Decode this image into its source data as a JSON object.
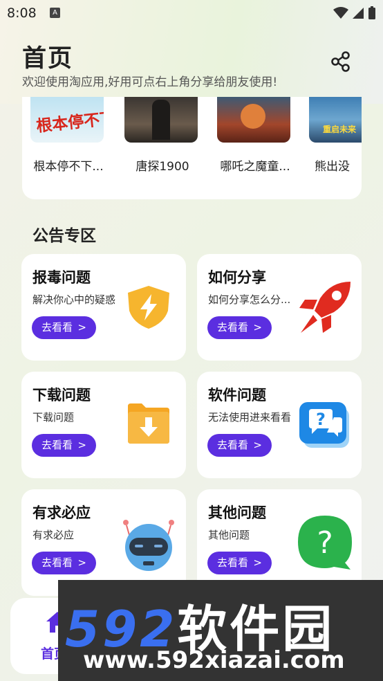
{
  "status_bar": {
    "time": "8:08",
    "notification_letter": "A"
  },
  "header": {
    "title": "首页",
    "subtitle": "欢迎使用淘应用,好用可点右上角分享给朋友使用!"
  },
  "movies": [
    {
      "name": "根本停不下...",
      "poster_text": "根本停不下来"
    },
    {
      "name": "唐探1900",
      "poster_text": ""
    },
    {
      "name": "哪吒之魔童...",
      "poster_text": ""
    },
    {
      "name": "熊出没",
      "poster_text": "重启未来"
    }
  ],
  "notice_section": {
    "title": "公告专区",
    "button_label": "去看看",
    "cards": [
      {
        "title": "报毒问题",
        "desc": "解决你心中的疑惑",
        "icon": "shield-lightning-icon"
      },
      {
        "title": "如何分享",
        "desc": "如何分享怎么分...",
        "icon": "rocket-icon"
      },
      {
        "title": "下载问题",
        "desc": "下载问题",
        "icon": "download-folder-icon"
      },
      {
        "title": "软件问题",
        "desc": "无法使用进来看看",
        "icon": "question-chat-icon"
      },
      {
        "title": "有求必应",
        "desc": "有求必应",
        "icon": "robot-icon"
      },
      {
        "title": "其他问题",
        "desc": "其他问题",
        "icon": "question-bubble-icon"
      }
    ]
  },
  "tabbar": {
    "home_label": "首页"
  },
  "watermark": {
    "main": "592",
    "cn": "软件园",
    "url": "www.592xiazai.com"
  },
  "colors": {
    "accent": "#5b2ee0",
    "shield": "#f6b52e",
    "rocket": "#e02b20",
    "folder": "#f5a623",
    "chat": "#1e88e5",
    "bubble": "#2bb24c"
  }
}
